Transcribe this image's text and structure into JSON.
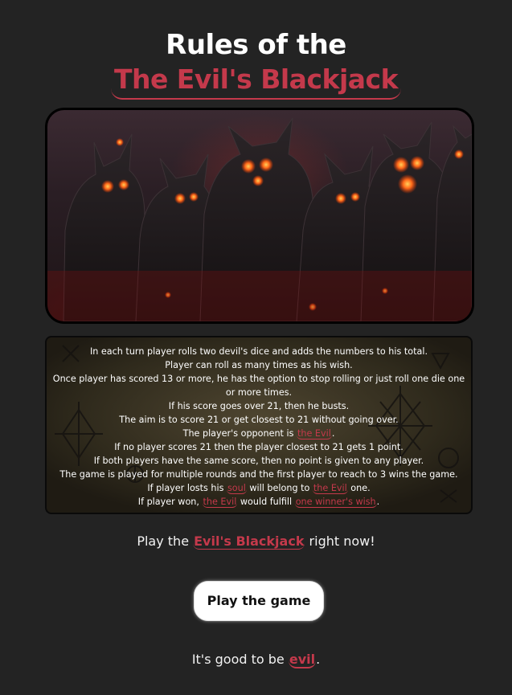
{
  "title": {
    "line1": "Rules of the",
    "line2": "The Evil's Blackjack"
  },
  "hero_image": {
    "alt": "Evil demons"
  },
  "rules": {
    "l1": "In each turn player rolls two devil's dice and adds the numbers to his total.",
    "l2": "Player can roll as many times as his wish.",
    "l3": "Once player has scored 13 or more, he has the option to stop rolling or just roll one die one or more times.",
    "l4": "If his score goes over 21, then he busts.",
    "l5": "The aim is to score 21 or get closest to 21 without going over.",
    "l6_pre": "The player's opponent is ",
    "l6_hl": "the Evil",
    "l6_post": ".",
    "l7": "If no player scores 21 then the player closest to 21 gets 1 point.",
    "l8": "If both players have the same score, then no point is given to any player.",
    "l9": "The game is played for multiple rounds and the first player to reach to 3 wins the game.",
    "l10_pre": "If player losts his ",
    "l10_hl1": "soul",
    "l10_mid": " will belong to ",
    "l10_hl2": "the Evil",
    "l10_post": " one.",
    "l11_pre": "If player won, ",
    "l11_hl1": "the Evil",
    "l11_mid": " would fulfill ",
    "l11_hl2": "one winner's wish",
    "l11_post": "."
  },
  "cta": {
    "pre": "Play the ",
    "highlight": "Evil's Blackjack",
    "post": " right now!"
  },
  "play_button": {
    "label": "Play the game"
  },
  "footer": {
    "pre": "It's good to be ",
    "highlight": "evil",
    "post": "."
  },
  "colors": {
    "background": "#232323",
    "accent": "#c4394b",
    "text": "#f2f2f2",
    "button_bg": "#ffffff"
  }
}
